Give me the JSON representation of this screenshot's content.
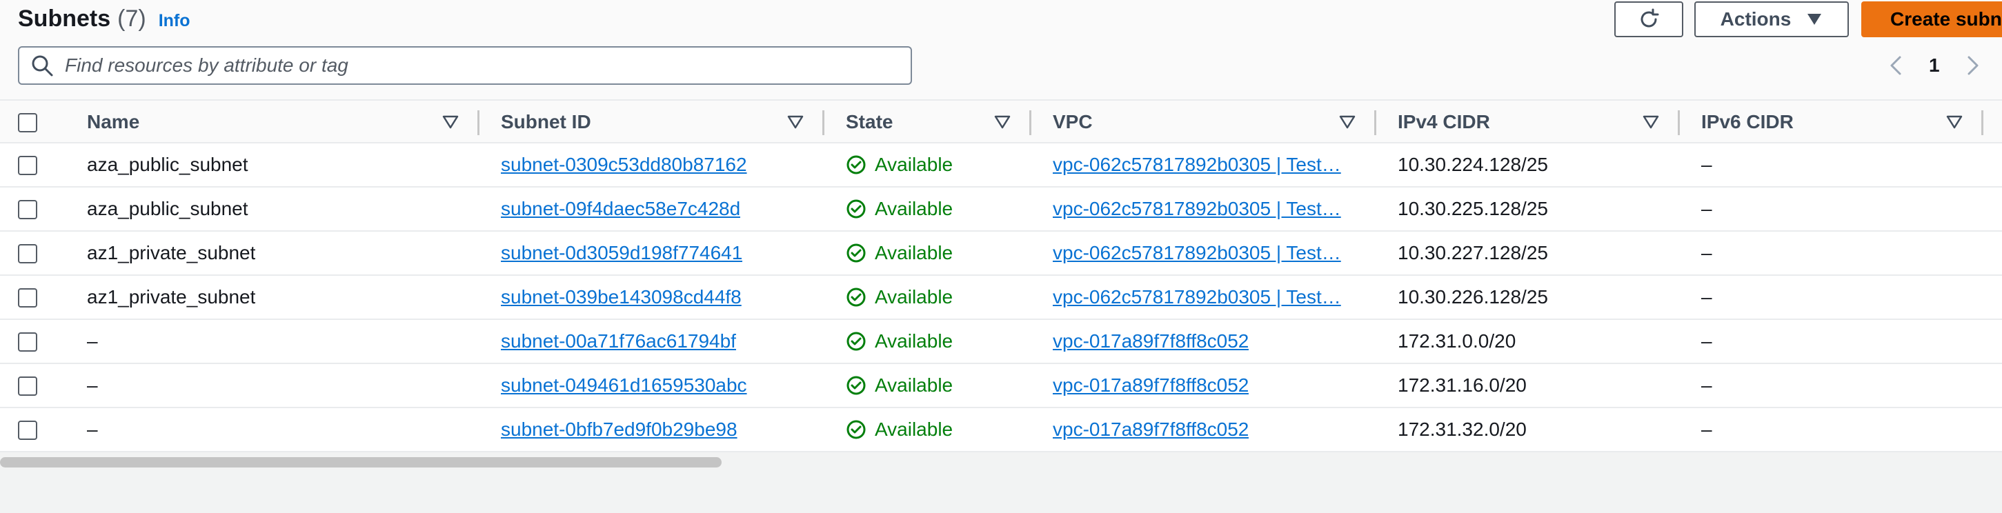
{
  "header": {
    "title": "Subnets",
    "count": "(7)",
    "info_label": "Info",
    "actions_label": "Actions",
    "create_label": "Create subnet",
    "search_placeholder": "Find resources by attribute or tag",
    "page_number": "1"
  },
  "table": {
    "columns": [
      "Name",
      "Subnet ID",
      "State",
      "VPC",
      "IPv4 CIDR",
      "IPv6 CIDR"
    ],
    "rows": [
      {
        "name": "aza_public_subnet",
        "subnet_id": "subnet-0309c53dd80b87162",
        "state": "Available",
        "vpc": "vpc-062c57817892b0305 | Test…",
        "ipv4": "10.30.224.128/25",
        "ipv6": "–"
      },
      {
        "name": "aza_public_subnet",
        "subnet_id": "subnet-09f4daec58e7c428d",
        "state": "Available",
        "vpc": "vpc-062c57817892b0305 | Test…",
        "ipv4": "10.30.225.128/25",
        "ipv6": "–"
      },
      {
        "name": "az1_private_subnet",
        "subnet_id": "subnet-0d3059d198f774641",
        "state": "Available",
        "vpc": "vpc-062c57817892b0305 | Test…",
        "ipv4": "10.30.227.128/25",
        "ipv6": "–"
      },
      {
        "name": "az1_private_subnet",
        "subnet_id": "subnet-039be143098cd44f8",
        "state": "Available",
        "vpc": "vpc-062c57817892b0305 | Test…",
        "ipv4": "10.30.226.128/25",
        "ipv6": "–"
      },
      {
        "name": "–",
        "subnet_id": "subnet-00a71f76ac61794bf",
        "state": "Available",
        "vpc": "vpc-017a89f7f8ff8c052",
        "ipv4": "172.31.0.0/20",
        "ipv6": "–"
      },
      {
        "name": "–",
        "subnet_id": "subnet-049461d1659530abc",
        "state": "Available",
        "vpc": "vpc-017a89f7f8ff8c052",
        "ipv4": "172.31.16.0/20",
        "ipv6": "–"
      },
      {
        "name": "–",
        "subnet_id": "subnet-0bfb7ed9f0b29be98",
        "state": "Available",
        "vpc": "vpc-017a89f7f8ff8c052",
        "ipv4": "172.31.32.0/20",
        "ipv6": "–"
      }
    ]
  },
  "colors": {
    "link": "#0972d3",
    "available": "#037f0c",
    "primary_button": "#ec7211"
  },
  "icons": [
    "refresh-icon",
    "caret-down-icon",
    "search-icon",
    "chevron-left-icon",
    "chevron-right-icon",
    "sort-icon",
    "status-check-icon"
  ]
}
